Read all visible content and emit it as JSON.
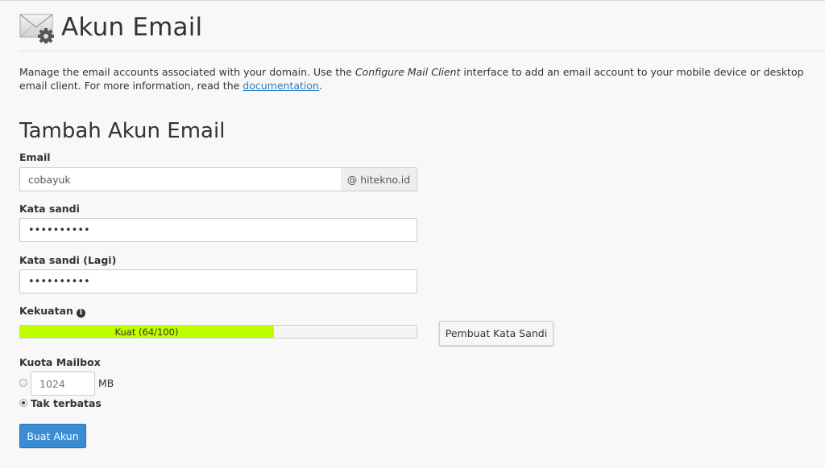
{
  "header": {
    "title": "Akun Email",
    "icon": "email-gear-icon"
  },
  "description": {
    "part1": "Manage the email accounts associated with your domain. Use the ",
    "emphasis": "Configure Mail Client",
    "part2": " interface to add an email account to your mobile device or desktop email client. For more information, read the ",
    "link_text": "documentation",
    "part3": "."
  },
  "form": {
    "section_title": "Tambah Akun Email",
    "email": {
      "label": "Email",
      "value": "cobayuk",
      "domain_addon": "@ hitekno.id"
    },
    "password": {
      "label": "Kata sandi",
      "masked_value": "••••••••••"
    },
    "password_confirm": {
      "label": "Kata sandi (Lagi)",
      "masked_value": "••••••••••"
    },
    "strength": {
      "label": "Kekuatan",
      "text": "Kuat (64/100)",
      "score": 64,
      "max": 100,
      "bar_color": "#bfff00",
      "info_icon": "info-circle-icon"
    },
    "generator_button": "Pembuat Kata Sandi",
    "quota": {
      "label": "Kuota Mailbox",
      "placeholder": "1024",
      "unit": "MB",
      "unlimited_label": "Tak terbatas",
      "selected": "unlimited"
    },
    "submit_button": "Buat Akun"
  },
  "colors": {
    "primary": "#3a8cd3",
    "link": "#2a7bbf"
  }
}
